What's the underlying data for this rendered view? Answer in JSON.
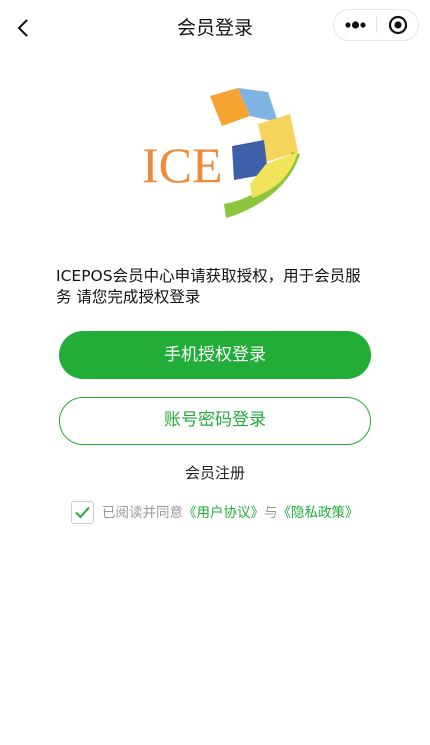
{
  "nav": {
    "title": "会员登录",
    "back_icon": "chevron-left-icon",
    "more_icon": "more-dots-icon",
    "target_icon": "target-circle-icon"
  },
  "logo": {
    "text": "ICE",
    "colors": [
      "#f08a3a",
      "#3f6fb6",
      "#7fb5e0",
      "#f4c542",
      "#8cc63f"
    ]
  },
  "main": {
    "description": "ICEPOS会员中心申请获取授权，用于会员服务 请您完成授权登录",
    "phone_login_label": "手机授权登录",
    "account_login_label": "账号密码登录",
    "register_label": "会员注册"
  },
  "agreement": {
    "checked": true,
    "prefix": "已阅读并同意",
    "user_agreement": "《用户协议》",
    "conjunction": "与",
    "privacy_policy": "《隐私政策》"
  },
  "colors": {
    "accent": "#22ac38"
  }
}
